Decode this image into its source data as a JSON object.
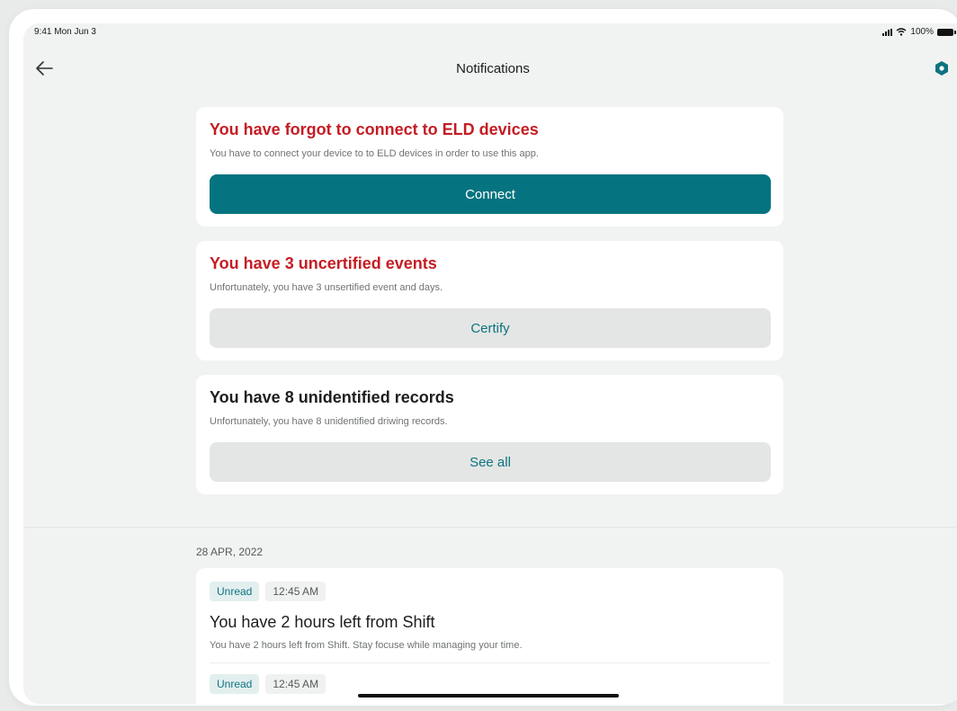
{
  "status_bar": {
    "time": "9:41 Mon Jun 3",
    "battery": "100%"
  },
  "nav": {
    "title": "Notifications",
    "back_icon": "arrow-left-icon",
    "settings_icon": "hexagon-gear-icon"
  },
  "alerts": [
    {
      "title": "You have forgot to connect to ELD devices",
      "subtitle": "You have to connect your device to to ELD devices in order to use this app.",
      "button": "Connect",
      "title_color": "#c41d24"
    },
    {
      "title": "You have 3 uncertified events",
      "subtitle": "Unfortunately, you have 3 unsertified event and days.",
      "button": "Certify",
      "title_color": "#c41d24"
    },
    {
      "title": "You have 8 unidentified records",
      "subtitle": "Unfortunately, you have 8 unidentified driwing records.",
      "button": "See all",
      "title_color": "#1e1e1e"
    }
  ],
  "date_header": "28 APR, 2022",
  "notifications": [
    {
      "status": "Unread",
      "time": "12:45 AM",
      "title": "You have 2 hours left from Shift",
      "body": "You have 2 hours left from Shift. Stay focuse while managing your time."
    },
    {
      "status": "Unread",
      "time": "12:45 AM"
    }
  ],
  "colors": {
    "accent": "#067480",
    "alert_red": "#c41d24",
    "background": "#f1f2f2"
  }
}
